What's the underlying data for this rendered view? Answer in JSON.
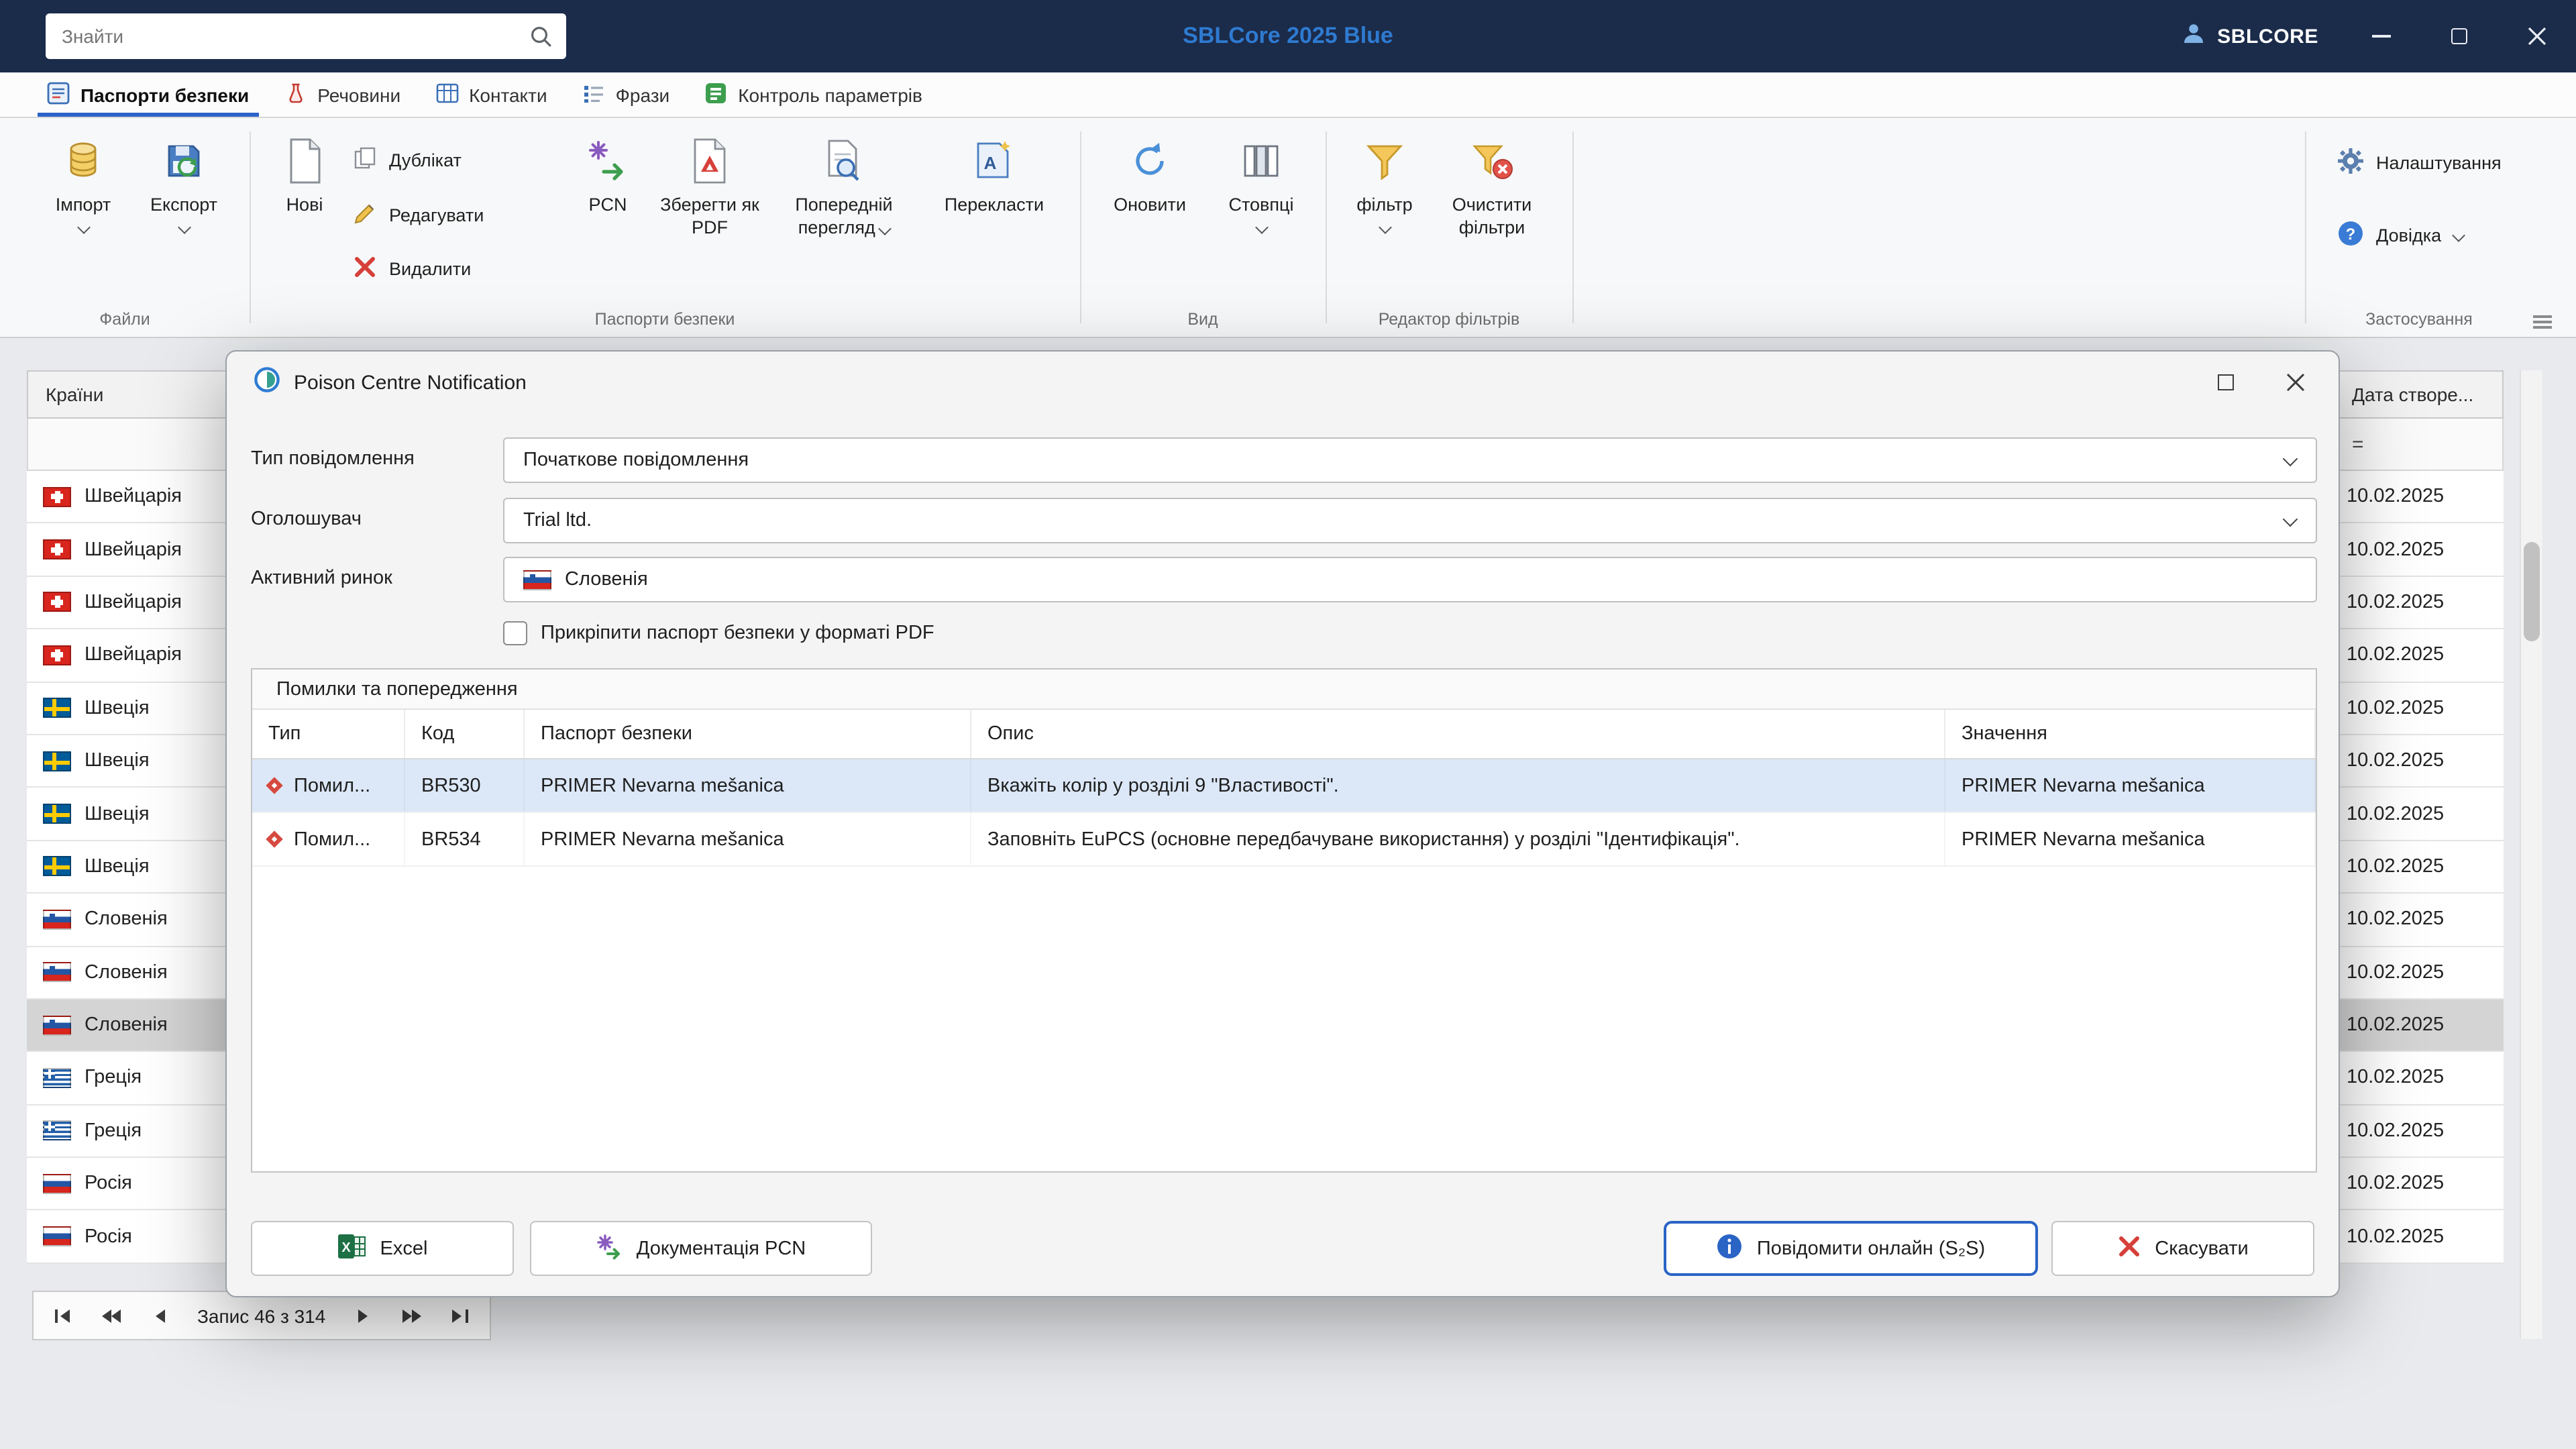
{
  "titlebar": {
    "search_placeholder": "Знайти",
    "app_title": "SBLCore 2025 Blue",
    "account_label": "SBLCORE"
  },
  "tabs": [
    {
      "label": "Паспорти безпеки"
    },
    {
      "label": "Речовини"
    },
    {
      "label": "Контакти"
    },
    {
      "label": "Фрази"
    },
    {
      "label": "Контроль параметрів"
    }
  ],
  "ribbon": {
    "groups": {
      "files": "Файли",
      "sds": "Паспорти безпеки",
      "view": "Вид",
      "filter_editor": "Редактор фільтрів",
      "application": "Застосування"
    },
    "buttons": {
      "import": "Імпорт",
      "export": "Експорт",
      "new": "Нові",
      "duplicate": "Дублікат",
      "edit": "Редагувати",
      "delete": "Видалити",
      "pcn": "PCN",
      "save_pdf": "Зберегти як PDF",
      "preview": "Попередній перегляд",
      "translate": "Перекласти",
      "refresh": "Оновити",
      "columns": "Стовпці",
      "filter": "фільтр",
      "clear_filters": "Очистити фільтри",
      "settings": "Налаштування",
      "help": "Довідка"
    }
  },
  "grid": {
    "countries_header": "Країни",
    "dates_header": "Дата створе...",
    "date_filter_symbol": "=",
    "rows": [
      {
        "country": "Швейцарія",
        "flag": "ch",
        "date": "10.02.2025",
        "selected": false
      },
      {
        "country": "Швейцарія",
        "flag": "ch",
        "date": "10.02.2025",
        "selected": false
      },
      {
        "country": "Швейцарія",
        "flag": "ch",
        "date": "10.02.2025",
        "selected": false
      },
      {
        "country": "Швейцарія",
        "flag": "ch",
        "date": "10.02.2025",
        "selected": false
      },
      {
        "country": "Швеція",
        "flag": "se",
        "date": "10.02.2025",
        "selected": false
      },
      {
        "country": "Швеція",
        "flag": "se",
        "date": "10.02.2025",
        "selected": false
      },
      {
        "country": "Швеція",
        "flag": "se",
        "date": "10.02.2025",
        "selected": false
      },
      {
        "country": "Швеція",
        "flag": "se",
        "date": "10.02.2025",
        "selected": false
      },
      {
        "country": "Словенія",
        "flag": "si",
        "date": "10.02.2025",
        "selected": false
      },
      {
        "country": "Словенія",
        "flag": "si",
        "date": "10.02.2025",
        "selected": false
      },
      {
        "country": "Словенія",
        "flag": "si",
        "date": "10.02.2025",
        "selected": true
      },
      {
        "country": "Греція",
        "flag": "gr",
        "date": "10.02.2025",
        "selected": false
      },
      {
        "country": "Греція",
        "flag": "gr",
        "date": "10.02.2025",
        "selected": false
      },
      {
        "country": "Росія",
        "flag": "ru",
        "date": "10.02.2025",
        "selected": false
      },
      {
        "country": "Росія",
        "flag": "ru",
        "date": "10.02.2025",
        "selected": false
      }
    ]
  },
  "pager": {
    "label": "Запис 46 з 314"
  },
  "dialog": {
    "title": "Poison Centre Notification",
    "fields": {
      "type_label": "Тип повідомлення",
      "type_value": "Початкове повідомлення",
      "notifier_label": "Оголошувач",
      "notifier_value": "Trial ltd.",
      "market_label": "Активний ринок",
      "market_value": "Словенія",
      "attach_label": "Прикріпити паспорт безпеки у форматі PDF"
    },
    "errors": {
      "title": "Помилки та попередження",
      "columns": [
        "Тип",
        "Код",
        "Паспорт безпеки",
        "Опис",
        "Значення"
      ],
      "rows": [
        {
          "type": "Помил...",
          "code": "BR530",
          "sds": "PRIMER Nevarna mešanica",
          "description": "Вкажіть колір у розділі 9 \"Властивості\".",
          "value": "PRIMER Nevarna mešanica",
          "selected": true
        },
        {
          "type": "Помил...",
          "code": "BR534",
          "sds": "PRIMER Nevarna mešanica",
          "description": "Заповніть EuPCS (основне передбачуване використання) у розділі \"Ідентифікація\".",
          "value": "PRIMER Nevarna mešanica",
          "selected": false
        }
      ]
    },
    "buttons": {
      "excel": "Excel",
      "pcn_docs": "Документація PCN",
      "notify": "Повідомити онлайн (S₂S)",
      "cancel": "Скасувати"
    }
  }
}
